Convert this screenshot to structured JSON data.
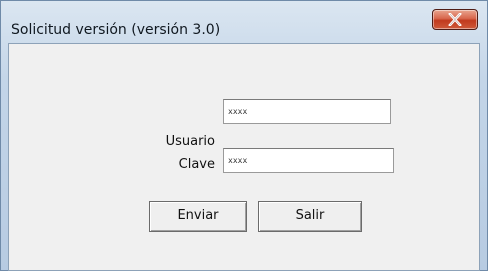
{
  "window": {
    "title": "Solicitud versión (versión 3.0)",
    "close_icon": "close-x-icon"
  },
  "form": {
    "user_label": "Usuario",
    "user_value": "xxxx",
    "password_label": "Clave",
    "password_value": "xxxx"
  },
  "buttons": {
    "send_label": "Enviar",
    "exit_label": "Salir"
  },
  "colors": {
    "close_button": "#c13a1e",
    "dialog_background": "#f0f0f0",
    "title_bar": "#c3d5e8"
  }
}
